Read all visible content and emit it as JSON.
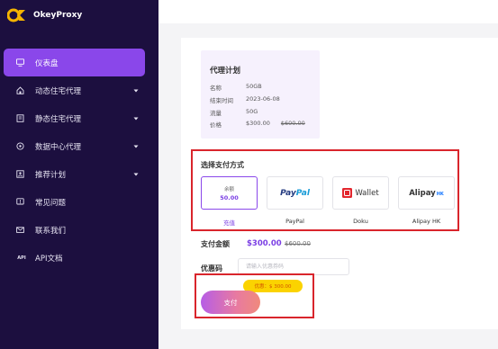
{
  "brand": {
    "name": "OkeyProxy"
  },
  "sidebar": {
    "items": [
      {
        "label": "仪表盘",
        "icon": "monitor-icon",
        "active": true
      },
      {
        "label": "动态住宅代理",
        "icon": "home-icon",
        "has_chevron": true
      },
      {
        "label": "静态住宅代理",
        "icon": "building-icon",
        "has_chevron": true
      },
      {
        "label": "数据中心代理",
        "icon": "database-icon",
        "has_chevron": true
      },
      {
        "label": "推荐计划",
        "icon": "referral-icon",
        "has_chevron": true
      },
      {
        "label": "常见问题",
        "icon": "faq-icon"
      },
      {
        "label": "联系我们",
        "icon": "mail-icon"
      },
      {
        "label": "API文档",
        "icon": "api-icon",
        "icon_text": "API"
      }
    ]
  },
  "plan": {
    "title": "代理计划",
    "rows": [
      {
        "key": "名称",
        "value": "50GB"
      },
      {
        "key": "结束时间",
        "value": "2023-06-08"
      },
      {
        "key": "流量",
        "value": "50G"
      },
      {
        "key": "价格",
        "value": "$300.00",
        "original": "$600.00"
      }
    ]
  },
  "payment": {
    "title": "选择支付方式",
    "methods": [
      {
        "label": "充值",
        "card_title": "余额",
        "card_amount": "50.00",
        "selected": true
      },
      {
        "label": "PayPal",
        "logo_text_1": "Pay",
        "logo_text_2": "Pal"
      },
      {
        "label": "Doku",
        "logo_text": "Wallet"
      },
      {
        "label": "Alipay HK",
        "logo_text": "Alipay",
        "logo_suffix": "HK"
      }
    ]
  },
  "amount": {
    "label": "支付金额",
    "value": "$300.00",
    "original": "$600.00"
  },
  "coupon": {
    "label": "优惠码",
    "placeholder": "请输入优惠券码"
  },
  "discount": {
    "text": "优惠：$ 300.00"
  },
  "pay_button": {
    "label": "支付"
  },
  "colors": {
    "sidebar": "#1c0f3f",
    "accent": "#8a47ea",
    "highlight": "#d9252c"
  }
}
